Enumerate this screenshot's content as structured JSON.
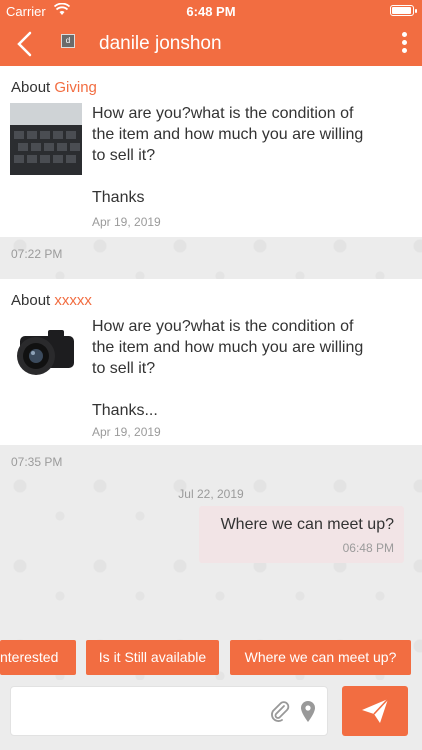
{
  "status_bar": {
    "carrier": "Carrier",
    "time": "6:48 PM"
  },
  "header": {
    "contact_name": "danile jonshon",
    "avatar_initial": "d"
  },
  "conversations": [
    {
      "about_label": "About",
      "item_name": "Giving",
      "message_lines": [
        "How are you?what is the condition of",
        "the item and how much you are willing",
        "to sell it?",
        "",
        "Thanks"
      ],
      "date": "Apr 19, 2019",
      "timestamp": "07:22 PM"
    },
    {
      "about_label": "About",
      "item_name": "xxxxx",
      "message_lines": [
        "How are you?what is the condition of",
        "the item and how much you are willing",
        "to sell it?",
        "",
        "Thanks..."
      ],
      "date": "Apr 19, 2019",
      "timestamp": "07:35 PM"
    }
  ],
  "day_separator": "Jul 22, 2019",
  "outgoing_message": {
    "text": "Where we can meet up?",
    "time": "06:48 PM"
  },
  "quick_replies": [
    "nterested",
    "Is it Still available",
    "Where we can meet up?"
  ],
  "composer": {
    "placeholder": ""
  },
  "colors": {
    "accent": "#f26d41",
    "outgoing_bubble": "#f2e4e6"
  }
}
